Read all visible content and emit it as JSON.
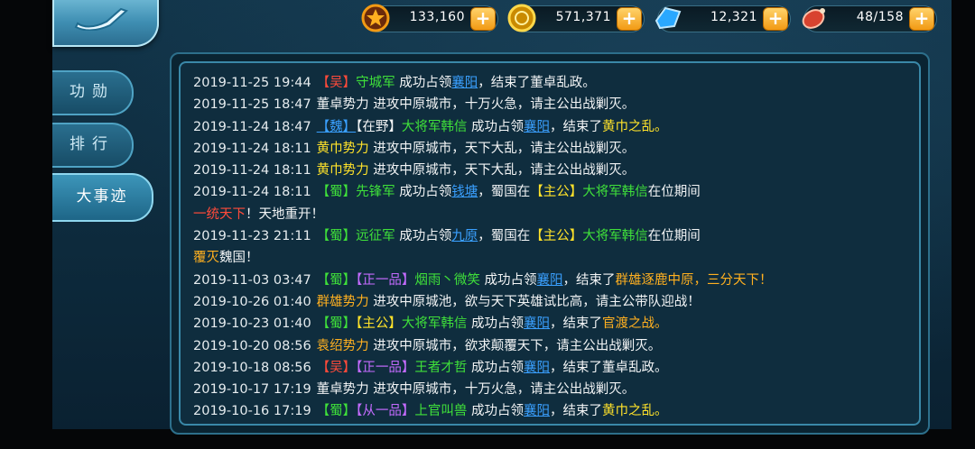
{
  "resources": [
    {
      "name": "merit",
      "icon": "medal-icon",
      "value": "133,160",
      "color": "#f29a14"
    },
    {
      "name": "gold",
      "icon": "gold-coin-icon",
      "value": "571,371",
      "color": "#f2c100"
    },
    {
      "name": "gem",
      "icon": "blue-gem-icon",
      "value": "12,321",
      "color": "#2aa8ff"
    },
    {
      "name": "stamina",
      "icon": "meat-icon",
      "value": "48/158",
      "color": "#e24b3a"
    }
  ],
  "tabs": [
    {
      "label": "功勋",
      "active": false
    },
    {
      "label": "排行",
      "active": false
    },
    {
      "label": "大事迹",
      "active": true
    }
  ],
  "log": [
    {
      "time": "2019-11-25  19:44",
      "segments": [
        {
          "t": "【吴】",
          "c": "red"
        },
        {
          "t": "守城军",
          "c": "green"
        },
        {
          "t": " 成功占领",
          "c": "white"
        },
        {
          "t": "襄阳",
          "c": "link"
        },
        {
          "t": "，结束了",
          "c": "white"
        },
        {
          "t": "董卓乱政。",
          "c": "white"
        }
      ]
    },
    {
      "time": "2019-11-25  18:47",
      "segments": [
        {
          "t": "董卓势力",
          "c": "white"
        },
        {
          "t": " 进攻中原城市，十万火急，请主公出战剿灭。",
          "c": "white"
        }
      ]
    },
    {
      "time": "2019-11-24  18:47",
      "segments": [
        {
          "t": "【魏】",
          "c": "link"
        },
        {
          "t": "【在野】",
          "c": "white"
        },
        {
          "t": "大将军韩信",
          "c": "green"
        },
        {
          "t": " 成功占领",
          "c": "white"
        },
        {
          "t": "襄阳",
          "c": "link"
        },
        {
          "t": "，结束了",
          "c": "white"
        },
        {
          "t": "黄巾之乱。",
          "c": "yellow"
        }
      ]
    },
    {
      "time": "2019-11-24  18:11",
      "segments": [
        {
          "t": "黄巾势力",
          "c": "yellow"
        },
        {
          "t": " 进攻中原城市，天下大乱，请主公出战剿灭。",
          "c": "white"
        }
      ]
    },
    {
      "time": "2019-11-24  18:11",
      "segments": [
        {
          "t": "黄巾势力",
          "c": "yellow"
        },
        {
          "t": " 进攻中原城市，天下大乱，请主公出战剿灭。",
          "c": "white"
        }
      ]
    },
    {
      "time": "2019-11-24  18:11",
      "segments": [
        {
          "t": "【蜀】",
          "c": "green"
        },
        {
          "t": "先锋军",
          "c": "green"
        },
        {
          "t": " 成功占领",
          "c": "white"
        },
        {
          "t": "钱塘",
          "c": "link"
        },
        {
          "t": "，蜀国在",
          "c": "white"
        },
        {
          "t": "【主公】",
          "c": "yellow"
        },
        {
          "t": "大将军韩信",
          "c": "green"
        },
        {
          "t": "在位期间",
          "c": "white"
        }
      ]
    },
    {
      "time": "",
      "segments": [
        {
          "t": "一统天下",
          "c": "red"
        },
        {
          "t": "！天地重开！",
          "c": "white"
        }
      ]
    },
    {
      "time": "2019-11-23  21:11",
      "segments": [
        {
          "t": "【蜀】",
          "c": "green"
        },
        {
          "t": "远征军",
          "c": "green"
        },
        {
          "t": " 成功占领",
          "c": "white"
        },
        {
          "t": "九原",
          "c": "link"
        },
        {
          "t": "，蜀国在",
          "c": "white"
        },
        {
          "t": "【主公】",
          "c": "yellow"
        },
        {
          "t": "大将军韩信",
          "c": "green"
        },
        {
          "t": "在位期间",
          "c": "white"
        }
      ]
    },
    {
      "time": "",
      "segments": [
        {
          "t": "覆灭",
          "c": "gold"
        },
        {
          "t": "魏国！",
          "c": "white"
        }
      ]
    },
    {
      "time": "2019-11-03  03:47",
      "segments": [
        {
          "t": "【蜀】",
          "c": "green"
        },
        {
          "t": "【正一品】",
          "c": "purple"
        },
        {
          "t": "烟雨丶微笑",
          "c": "green"
        },
        {
          "t": " 成功占领",
          "c": "white"
        },
        {
          "t": "襄阳",
          "c": "link"
        },
        {
          "t": "，结束了",
          "c": "white"
        },
        {
          "t": "群雄逐鹿中原，三分天下！",
          "c": "gold"
        }
      ]
    },
    {
      "time": "2019-10-26  01:40",
      "segments": [
        {
          "t": "群雄势力",
          "c": "gold"
        },
        {
          "t": " 进攻中原城池，欲与天下英雄试比高，请主公带队迎战！",
          "c": "white"
        }
      ]
    },
    {
      "time": "2019-10-23  01:40",
      "segments": [
        {
          "t": "【蜀】",
          "c": "green"
        },
        {
          "t": "【主公】",
          "c": "yellow"
        },
        {
          "t": "大将军韩信",
          "c": "green"
        },
        {
          "t": " 成功占领",
          "c": "white"
        },
        {
          "t": "襄阳",
          "c": "link"
        },
        {
          "t": "，结束了",
          "c": "white"
        },
        {
          "t": "官渡之战。",
          "c": "gold"
        }
      ]
    },
    {
      "time": "2019-10-20  08:56",
      "segments": [
        {
          "t": "袁绍势力",
          "c": "gold"
        },
        {
          "t": " 进攻中原城市，欲求颠覆天下，请主公出战剿灭。",
          "c": "white"
        }
      ]
    },
    {
      "time": "2019-10-18  08:56",
      "segments": [
        {
          "t": "【吴】",
          "c": "red"
        },
        {
          "t": "【正一品】",
          "c": "purple"
        },
        {
          "t": "王者才哲",
          "c": "green"
        },
        {
          "t": " 成功占领",
          "c": "white"
        },
        {
          "t": "襄阳",
          "c": "link"
        },
        {
          "t": "，结束了",
          "c": "white"
        },
        {
          "t": "董卓乱政。",
          "c": "white"
        }
      ]
    },
    {
      "time": "2019-10-17  17:19",
      "segments": [
        {
          "t": "董卓势力",
          "c": "white"
        },
        {
          "t": " 进攻中原城市，十万火急，请主公出战剿灭。",
          "c": "white"
        }
      ]
    },
    {
      "time": "2019-10-16  17:19",
      "segments": [
        {
          "t": "【蜀】",
          "c": "green"
        },
        {
          "t": "【从一品】",
          "c": "purple"
        },
        {
          "t": "上官叫兽",
          "c": "green"
        },
        {
          "t": " 成功占领",
          "c": "white"
        },
        {
          "t": "襄阳",
          "c": "link"
        },
        {
          "t": "，结束了",
          "c": "white"
        },
        {
          "t": "黄巾之乱。",
          "c": "yellow"
        }
      ]
    }
  ]
}
